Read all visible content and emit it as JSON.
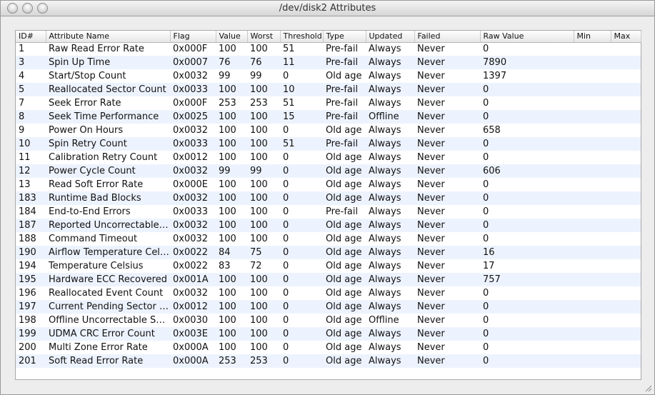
{
  "window": {
    "title": "/dev/disk2 Attributes"
  },
  "columns": [
    "ID#",
    "Attribute Name",
    "Flag",
    "Value",
    "Worst",
    "Threshold",
    "Type",
    "Updated",
    "Failed",
    "Raw Value",
    "Min",
    "Max"
  ],
  "rows": [
    [
      "1",
      "Raw Read Error Rate",
      "0x000F",
      "100",
      "100",
      "51",
      "Pre-fail",
      "Always",
      "Never",
      "0",
      "",
      ""
    ],
    [
      "3",
      "Spin Up Time",
      "0x0007",
      "76",
      "76",
      "11",
      "Pre-fail",
      "Always",
      "Never",
      "7890",
      "",
      ""
    ],
    [
      "4",
      "Start/Stop Count",
      "0x0032",
      "99",
      "99",
      "0",
      "Old age",
      "Always",
      "Never",
      "1397",
      "",
      ""
    ],
    [
      "5",
      "Reallocated Sector Count",
      "0x0033",
      "100",
      "100",
      "10",
      "Pre-fail",
      "Always",
      "Never",
      "0",
      "",
      ""
    ],
    [
      "7",
      "Seek Error Rate",
      "0x000F",
      "253",
      "253",
      "51",
      "Pre-fail",
      "Always",
      "Never",
      "0",
      "",
      ""
    ],
    [
      "8",
      "Seek Time Performance",
      "0x0025",
      "100",
      "100",
      "15",
      "Pre-fail",
      "Offline",
      "Never",
      "0",
      "",
      ""
    ],
    [
      "9",
      "Power On Hours",
      "0x0032",
      "100",
      "100",
      "0",
      "Old age",
      "Always",
      "Never",
      "658",
      "",
      ""
    ],
    [
      "10",
      "Spin Retry Count",
      "0x0033",
      "100",
      "100",
      "51",
      "Pre-fail",
      "Always",
      "Never",
      "0",
      "",
      ""
    ],
    [
      "11",
      "Calibration Retry Count",
      "0x0012",
      "100",
      "100",
      "0",
      "Old age",
      "Always",
      "Never",
      "0",
      "",
      ""
    ],
    [
      "12",
      "Power Cycle Count",
      "0x0032",
      "99",
      "99",
      "0",
      "Old age",
      "Always",
      "Never",
      "606",
      "",
      ""
    ],
    [
      "13",
      "Read Soft Error Rate",
      "0x000E",
      "100",
      "100",
      "0",
      "Old age",
      "Always",
      "Never",
      "0",
      "",
      ""
    ],
    [
      "183",
      "Runtime Bad Blocks",
      "0x0032",
      "100",
      "100",
      "0",
      "Old age",
      "Always",
      "Never",
      "0",
      "",
      ""
    ],
    [
      "184",
      "End-to-End Errors",
      "0x0033",
      "100",
      "100",
      "0",
      "Pre-fail",
      "Always",
      "Never",
      "0",
      "",
      ""
    ],
    [
      "187",
      "Reported Uncorrectable …",
      "0x0032",
      "100",
      "100",
      "0",
      "Old age",
      "Always",
      "Never",
      "0",
      "",
      ""
    ],
    [
      "188",
      "Command Timeout",
      "0x0032",
      "100",
      "100",
      "0",
      "Old age",
      "Always",
      "Never",
      "0",
      "",
      ""
    ],
    [
      "190",
      "Airflow Temperature Cel…",
      "0x0022",
      "84",
      "75",
      "0",
      "Old age",
      "Always",
      "Never",
      "16",
      "",
      ""
    ],
    [
      "194",
      "Temperature Celsius",
      "0x0022",
      "83",
      "72",
      "0",
      "Old age",
      "Always",
      "Never",
      "17",
      "",
      ""
    ],
    [
      "195",
      "Hardware ECC Recovered",
      "0x001A",
      "100",
      "100",
      "0",
      "Old age",
      "Always",
      "Never",
      "757",
      "",
      ""
    ],
    [
      "196",
      "Reallocated Event Count",
      "0x0032",
      "100",
      "100",
      "0",
      "Old age",
      "Always",
      "Never",
      "0",
      "",
      ""
    ],
    [
      "197",
      "Current Pending Sector …",
      "0x0012",
      "100",
      "100",
      "0",
      "Old age",
      "Always",
      "Never",
      "0",
      "",
      ""
    ],
    [
      "198",
      "Offline Uncorrectable Se…",
      "0x0030",
      "100",
      "100",
      "0",
      "Old age",
      "Offline",
      "Never",
      "0",
      "",
      ""
    ],
    [
      "199",
      "UDMA CRC Error Count",
      "0x003E",
      "100",
      "100",
      "0",
      "Old age",
      "Always",
      "Never",
      "0",
      "",
      ""
    ],
    [
      "200",
      "Multi Zone Error Rate",
      "0x000A",
      "100",
      "100",
      "0",
      "Old age",
      "Always",
      "Never",
      "0",
      "",
      ""
    ],
    [
      "201",
      "Soft Read Error Rate",
      "0x000A",
      "253",
      "253",
      "0",
      "Old age",
      "Always",
      "Never",
      "0",
      "",
      ""
    ]
  ],
  "colors": {
    "row_stripe": "#edf3fe",
    "window_bg": "#ededed"
  },
  "icons": {
    "close": "close-icon",
    "minimize": "minimize-icon",
    "zoom": "zoom-icon",
    "resize": "resize-grip-icon"
  }
}
